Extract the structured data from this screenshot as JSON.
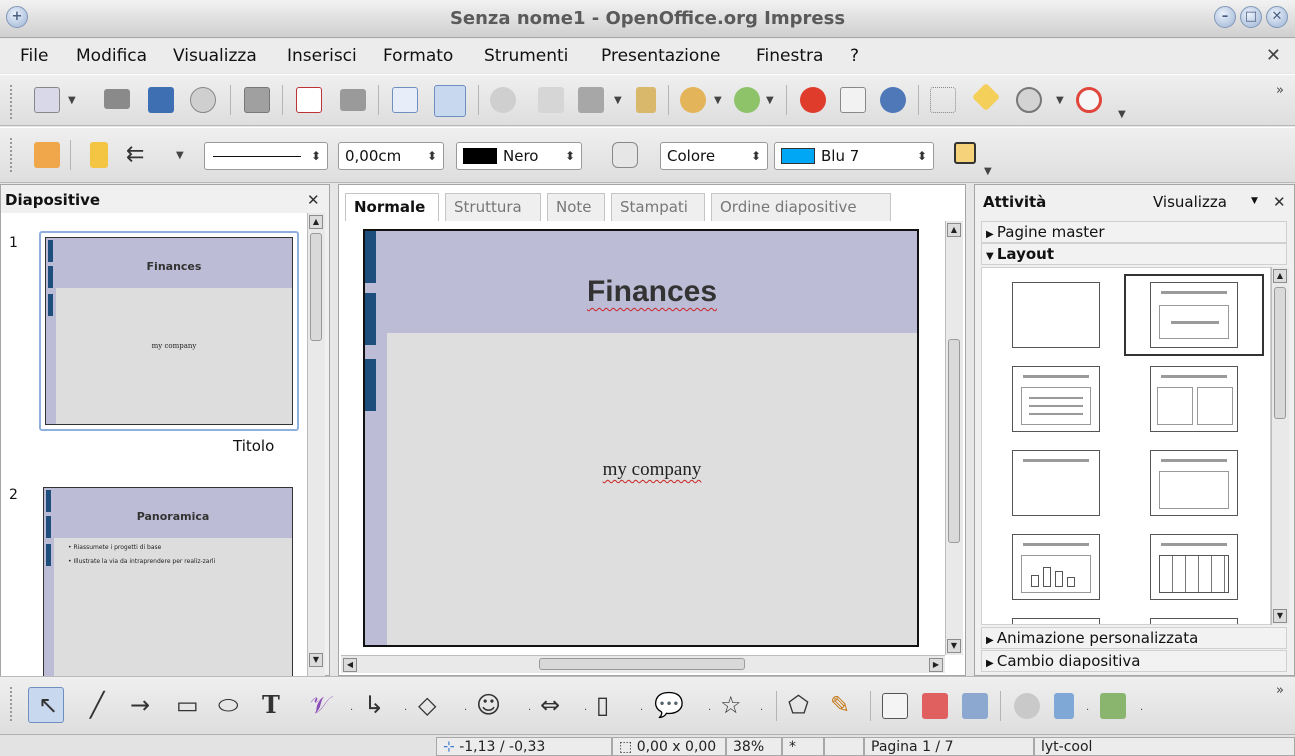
{
  "window": {
    "title": "Senza nome1 - OpenOffice.org Impress"
  },
  "menu": {
    "items": [
      "File",
      "Modifica",
      "Visualizza",
      "Inserisci",
      "Formato",
      "Strumenti",
      "Presentazione",
      "Finestra",
      "?"
    ]
  },
  "line_toolbar": {
    "line_width": "0,00cm",
    "line_color": "Nero",
    "area_style": "Colore",
    "area_color": "Blu 7",
    "colors": {
      "line": "#000000",
      "area": "#00a7f5"
    }
  },
  "slides_pane": {
    "title": "Diapositive",
    "slides": [
      {
        "number": "1",
        "title": "Finances",
        "body": "my company",
        "caption": "Titolo"
      },
      {
        "number": "2",
        "title": "Panoramica",
        "bullets": [
          "Riassumete i progetti di base",
          "Illustrate la via da intraprendere per realiz-zarli"
        ]
      }
    ]
  },
  "editor": {
    "tabs": [
      "Normale",
      "Struttura",
      "Note",
      "Stampati",
      "Ordine diapositive"
    ],
    "active_tab": "Normale",
    "slide": {
      "title": "Finances",
      "subtitle": "my company"
    }
  },
  "tasks_pane": {
    "title": "Attività",
    "view_menu": "Visualizza",
    "sections": [
      "Pagine master",
      "Layout",
      "Animazione personalizzata",
      "Cambio diapositiva"
    ],
    "expanded": "Layout"
  },
  "status": {
    "position": "-1,13 / -0,33",
    "size": "0,00 x 0,00",
    "zoom": "38%",
    "modified": "*",
    "page": "Pagina 1 / 7",
    "master": "lyt-cool"
  },
  "theme": {
    "slide_header": "#bcbcd6",
    "slide_marker": "#1e4e7c",
    "slide_body": "#dedede"
  }
}
